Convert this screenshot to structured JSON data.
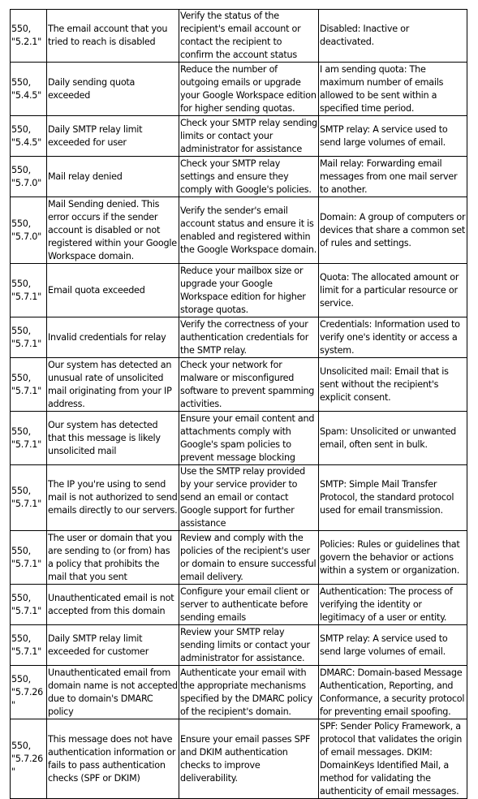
{
  "table": {
    "rows": [
      {
        "code": "550, \"5.2.1\"",
        "description": "The email account that you tried to reach is disabled",
        "resolution": "Verify the status of the recipient's email account or contact the recipient to confirm the account status",
        "definition": "Disabled: Inactive or deactivated."
      },
      {
        "code": "550, \"5.4.5\"",
        "description": "Daily sending quota exceeded",
        "resolution": "Reduce the number of outgoing emails or upgrade your Google Workspace edition for higher sending quotas.",
        "definition": "I am sending quota: The maximum number of emails allowed to be sent within a specified time period."
      },
      {
        "code": "550, \"5.4.5\"",
        "description": "Daily SMTP relay limit exceeded for user",
        "resolution": "Check your SMTP relay sending limits or contact your administrator for assistance",
        "definition": "SMTP relay: A service used to send large volumes of email."
      },
      {
        "code": "550, \"5.7.0\"",
        "description": "Mail relay denied",
        "resolution": "Check your SMTP relay settings and ensure they comply with Google's policies.",
        "definition": "Mail relay: Forwarding email messages from one mail server to another."
      },
      {
        "code": "550, \"5.7.0\"",
        "description": "Mail Sending denied. This error occurs if the sender account is disabled or not registered within your Google Workspace domain.",
        "resolution": "Verify the sender's email account status and ensure it is enabled and registered within the Google Workspace domain.",
        "definition": "Domain: A group of computers or devices that share a common set of rules and settings."
      },
      {
        "code": "550, \"5.7.1\"",
        "description": "Email quota exceeded",
        "resolution": "Reduce your mailbox size or upgrade your Google Workspace edition for higher storage quotas.",
        "definition": "Quota: The allocated amount or limit for a particular resource or service."
      },
      {
        "code": "550, \"5.7.1\"",
        "description": "Invalid credentials for relay",
        "resolution": "Verify the correctness of your authentication credentials for the SMTP relay.",
        "definition": "Credentials: Information used to verify one's identity or access a system."
      },
      {
        "code": "550, \"5.7.1\"",
        "description": "Our system has detected an unusual rate of unsolicited mail originating from your IP address.",
        "resolution": "Check your network for malware or misconfigured software to prevent spamming activities.",
        "definition": "Unsolicited mail: Email that is sent without the recipient's explicit consent."
      },
      {
        "code": "550, \"5.7.1\"",
        "description": "Our system has detected that this message is likely unsolicited mail",
        "resolution": "Ensure your email content and attachments comply with Google's spam policies to prevent message blocking",
        "definition": "Spam: Unsolicited or unwanted email, often sent in bulk."
      },
      {
        "code": "550, \"5.7.1\"",
        "description": "The IP you're using to send mail is not authorized to send emails directly to our servers.",
        "resolution": "Use the SMTP relay provided by your service provider to send an email or contact Google support for further assistance",
        "definition": "SMTP: Simple Mail Transfer Protocol, the standard protocol used for email transmission."
      },
      {
        "code": "550, \"5.7.1\"",
        "description": "The user or domain that you are sending to (or from) has a policy that prohibits the mail that you sent",
        "resolution": "Review and comply with the policies of the recipient's user or domain to ensure successful email delivery.",
        "definition": "Policies: Rules or guidelines that govern the behavior or actions within a system or organization."
      },
      {
        "code": "550, \"5.7.1\"",
        "description": "Unauthenticated email is not accepted from this domain",
        "resolution": "Configure your email client or server to authenticate before sending emails",
        "definition": "Authentication: The process of verifying the identity or legitimacy of a user or entity."
      },
      {
        "code": "550, \"5.7.1\"",
        "description": "Daily SMTP relay limit exceeded for customer",
        "resolution": "Review your SMTP relay sending limits or contact your administrator for assistance.",
        "definition": "SMTP relay: A service used to send large volumes of email."
      },
      {
        "code": "550, \"5.7.26\"",
        "description": "Unauthenticated email from domain name is not accepted due to domain's DMARC policy",
        "resolution": "Authenticate your email with the appropriate mechanisms specified by the DMARC policy of the recipient's domain.",
        "definition": "DMARC: Domain-based Message Authentication, Reporting, and Conformance, a security protocol for preventing email spoofing."
      },
      {
        "code": "550, \"5.7.26\"",
        "description": "This message does not have authentication information or fails to pass authentication checks (SPF or DKIM)",
        "resolution": "Ensure your email passes SPF and DKIM authentication checks to improve deliverability.",
        "definition": "SPF: Sender Policy Framework, a protocol that validates the origin of email messages. DKIM: DomainKeys Identified Mail, a method for validating the authenticity of email messages."
      }
    ]
  }
}
